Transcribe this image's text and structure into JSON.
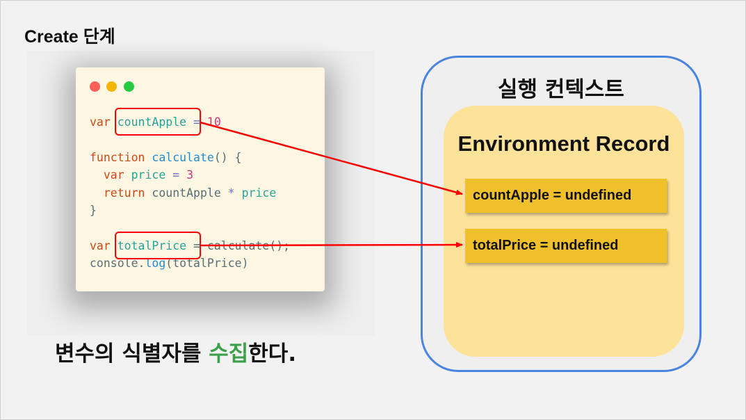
{
  "slide_title": "Create 단계",
  "code": {
    "line1": {
      "kw": "var",
      "id": "countApple",
      "op": " = ",
      "num": "10"
    },
    "line2": {
      "kw": "function",
      "fn": "calculate",
      "rest": "() {"
    },
    "line3": {
      "kw": "var",
      "id": "price",
      "op": " = ",
      "num": "3"
    },
    "line4": {
      "kw": "return",
      "id1": "countApple",
      "op": " * ",
      "id2": "price"
    },
    "line5": {
      "text": "}"
    },
    "line6": {
      "kw": "var",
      "id": "totalPrice",
      "rest": " = calculate();"
    },
    "line7": {
      "obj": "console.",
      "fn": "log",
      "rest": "(totalPrice)"
    }
  },
  "caption": {
    "before": "변수의 식별자를 ",
    "accent": "수집",
    "after": "한다."
  },
  "context": {
    "title": "실행 컨텍스트",
    "env_title": "Environment Record",
    "records": [
      "countApple = undefined",
      "totalPrice = undefined"
    ]
  },
  "colors": {
    "highlight": "#ff0000",
    "context_border": "#4a84e0",
    "env_bg": "#fde29a",
    "record_bg": "#f0bf2c",
    "caption_accent": "#3aa14a"
  }
}
